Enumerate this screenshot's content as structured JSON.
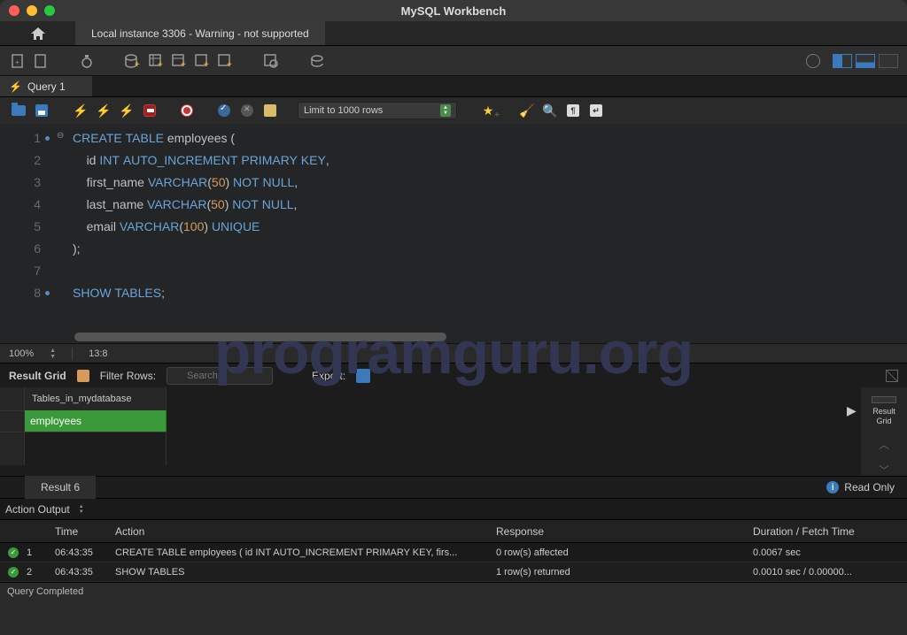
{
  "window_title": "MySQL Workbench",
  "connection_tab": "Local instance 3306 - Warning - not supported",
  "query_tab": "Query 1",
  "limit_select": "Limit to 1000 rows",
  "zoom": "100%",
  "cursor_pos": "13:8",
  "code": {
    "l1a": "CREATE",
    "l1b": "TABLE",
    "l1c": "employees (",
    "l2a": "id",
    "l2b": "INT",
    "l2c": "AUTO_INCREMENT",
    "l2d": "PRIMARY",
    "l2e": "KEY",
    "l2f": ",",
    "l3a": "first_name",
    "l3b": "VARCHAR",
    "l3c": "(",
    "l3d": "50",
    "l3e": ")",
    "l3f": "NOT",
    "l3g": "NULL",
    "l3h": ",",
    "l4a": "last_name",
    "l4b": "VARCHAR",
    "l4c": "(",
    "l4d": "50",
    "l4e": ")",
    "l4f": "NOT",
    "l4g": "NULL",
    "l4h": ",",
    "l5a": "email",
    "l5b": "VARCHAR",
    "l5c": "(",
    "l5d": "100",
    "l5e": ")",
    "l5f": "UNIQUE",
    "l6": ");",
    "l8a": "SHOW",
    "l8b": "TABLES",
    "l8c": ";"
  },
  "ln": {
    "1": "1",
    "2": "2",
    "3": "3",
    "4": "4",
    "5": "5",
    "6": "6",
    "7": "7",
    "8": "8"
  },
  "result": {
    "toolbar_label": "Result Grid",
    "filter_label": "Filter Rows:",
    "filter_placeholder": "Search",
    "export_label": "Export:",
    "column": "Tables_in_mydatabase",
    "row1": "employees",
    "tab": "Result 6",
    "readonly": "Read Only",
    "tray_label": "Result\nGrid"
  },
  "output": {
    "header": "Action Output",
    "col_time": "Time",
    "col_action": "Action",
    "col_response": "Response",
    "col_duration": "Duration / Fetch Time",
    "rows": [
      {
        "idx": "1",
        "time": "06:43:35",
        "action": "CREATE TABLE employees (     id INT AUTO_INCREMENT PRIMARY KEY,     firs...",
        "response": "0 row(s) affected",
        "duration": "0.0067 sec"
      },
      {
        "idx": "2",
        "time": "06:43:35",
        "action": "SHOW TABLES",
        "response": "1 row(s) returned",
        "duration": "0.0010 sec / 0.00000..."
      }
    ]
  },
  "status_text": "Query Completed",
  "watermark": "programguru.org"
}
